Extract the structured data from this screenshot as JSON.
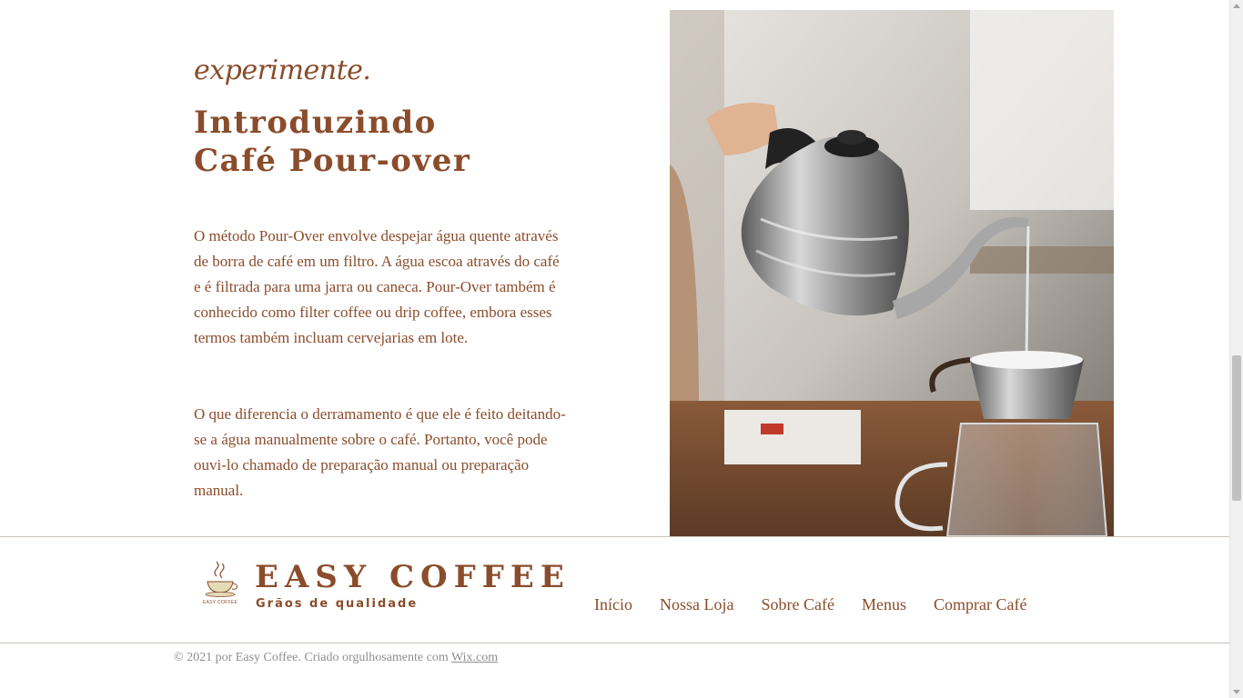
{
  "hero": {
    "script_heading": "experimente.",
    "title_line1": "Introduzindo",
    "title_line2": "Café Pour-over",
    "paragraph1": "O método Pour-Over envolve despejar água quente através de borra de café em um filtro. A água escoa através do café e é filtrada para uma jarra ou caneca. Pour-Over também é conhecido como filter coffee ou drip coffee, embora esses termos também incluam cervejarias em lote.",
    "paragraph2": "O que diferencia o derramamento é que ele é feito deitando-se a água manualmente sobre o café. Portanto, você pode ouvi-lo chamado de preparação manual ou preparação manual."
  },
  "footer": {
    "logo_tiny_text": "EASY COFFEE",
    "brand_name": "EASY COFFEE",
    "tagline": "Grãos de qualidade",
    "nav": [
      "Início",
      "Nossa Loja",
      "Sobre Café",
      "Menus",
      "Comprar Café"
    ],
    "copyright_text": "© 2021 por Easy Coffee. Criado orgulhosamente com ",
    "copyright_link": "Wix.com"
  },
  "colors": {
    "brand_brown": "#8a4c2b",
    "background": "#ffffff",
    "muted_text": "#8f8f8f"
  }
}
